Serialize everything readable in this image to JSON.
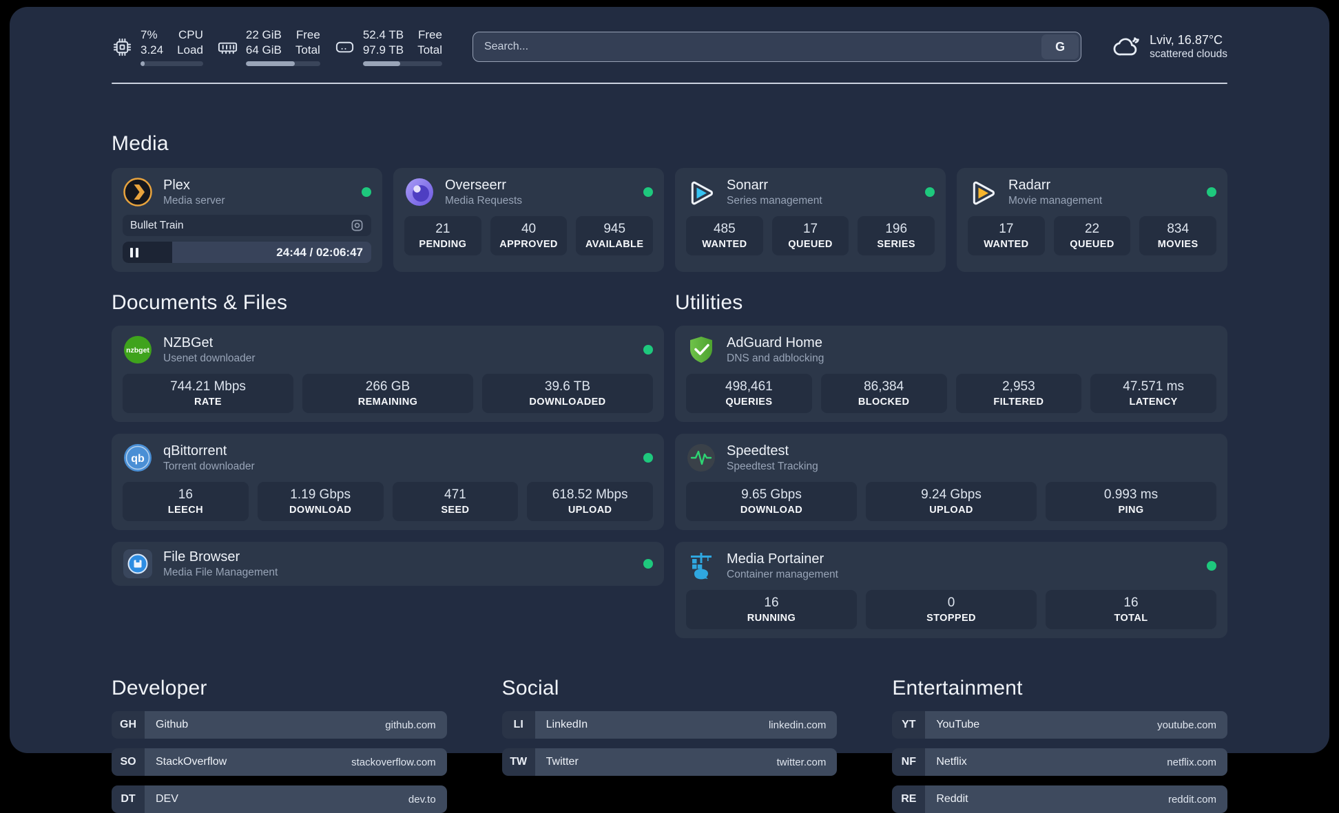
{
  "topbar": {
    "stats": [
      {
        "icon": "cpu",
        "v1": "7%",
        "v2": "3.24",
        "l1": "CPU",
        "l2": "Load",
        "progress": 7
      },
      {
        "icon": "ram",
        "v1": "22 GiB",
        "v2": "64 GiB",
        "l1": "Free",
        "l2": "Total",
        "progress": 66
      },
      {
        "icon": "disk",
        "v1": "52.4 TB",
        "v2": "97.9 TB",
        "l1": "Free",
        "l2": "Total",
        "progress": 47
      }
    ],
    "search": {
      "placeholder": "Search...",
      "engine": "G"
    },
    "weather": {
      "line1": "Lviv, 16.87°C",
      "line2": "scattered clouds"
    }
  },
  "media": {
    "heading": "Media",
    "plex": {
      "title": "Plex",
      "subtitle": "Media server",
      "now_playing": "Bullet Train",
      "time": "24:44 / 02:06:47",
      "progress": 20
    },
    "overseerr": {
      "title": "Overseerr",
      "subtitle": "Media Requests",
      "stats": [
        {
          "value": "21",
          "label": "PENDING"
        },
        {
          "value": "40",
          "label": "APPROVED"
        },
        {
          "value": "945",
          "label": "AVAILABLE"
        }
      ]
    },
    "sonarr": {
      "title": "Sonarr",
      "subtitle": "Series management",
      "stats": [
        {
          "value": "485",
          "label": "WANTED"
        },
        {
          "value": "17",
          "label": "QUEUED"
        },
        {
          "value": "196",
          "label": "SERIES"
        }
      ]
    },
    "radarr": {
      "title": "Radarr",
      "subtitle": "Movie management",
      "stats": [
        {
          "value": "17",
          "label": "WANTED"
        },
        {
          "value": "22",
          "label": "QUEUED"
        },
        {
          "value": "834",
          "label": "MOVIES"
        }
      ]
    }
  },
  "documents": {
    "heading": "Documents & Files",
    "nzbget": {
      "title": "NZBGet",
      "subtitle": "Usenet downloader",
      "stats": [
        {
          "value": "744.21 Mbps",
          "label": "RATE"
        },
        {
          "value": "266 GB",
          "label": "REMAINING"
        },
        {
          "value": "39.6 TB",
          "label": "DOWNLOADED"
        }
      ]
    },
    "qbittorrent": {
      "title": "qBittorrent",
      "subtitle": "Torrent downloader",
      "stats": [
        {
          "value": "16",
          "label": "LEECH"
        },
        {
          "value": "1.19 Gbps",
          "label": "DOWNLOAD"
        },
        {
          "value": "471",
          "label": "SEED"
        },
        {
          "value": "618.52 Mbps",
          "label": "UPLOAD"
        }
      ]
    },
    "filebrowser": {
      "title": "File Browser",
      "subtitle": "Media File Management"
    }
  },
  "utilities": {
    "heading": "Utilities",
    "adguard": {
      "title": "AdGuard Home",
      "subtitle": "DNS and adblocking",
      "stats": [
        {
          "value": "498,461",
          "label": "QUERIES"
        },
        {
          "value": "86,384",
          "label": "BLOCKED"
        },
        {
          "value": "2,953",
          "label": "FILTERED"
        },
        {
          "value": "47.571 ms",
          "label": "LATENCY"
        }
      ]
    },
    "speedtest": {
      "title": "Speedtest",
      "subtitle": "Speedtest Tracking",
      "stats": [
        {
          "value": "9.65 Gbps",
          "label": "DOWNLOAD"
        },
        {
          "value": "9.24 Gbps",
          "label": "UPLOAD"
        },
        {
          "value": "0.993 ms",
          "label": "PING"
        }
      ]
    },
    "portainer": {
      "title": "Media Portainer",
      "subtitle": "Container management",
      "stats": [
        {
          "value": "16",
          "label": "RUNNING"
        },
        {
          "value": "0",
          "label": "STOPPED"
        },
        {
          "value": "16",
          "label": "TOTAL"
        }
      ]
    }
  },
  "links": {
    "developer": {
      "heading": "Developer",
      "items": [
        {
          "abbr": "GH",
          "name": "Github",
          "url": "github.com"
        },
        {
          "abbr": "SO",
          "name": "StackOverflow",
          "url": "stackoverflow.com"
        },
        {
          "abbr": "DT",
          "name": "DEV",
          "url": "dev.to"
        }
      ]
    },
    "social": {
      "heading": "Social",
      "items": [
        {
          "abbr": "LI",
          "name": "LinkedIn",
          "url": "linkedin.com"
        },
        {
          "abbr": "TW",
          "name": "Twitter",
          "url": "twitter.com"
        }
      ]
    },
    "entertainment": {
      "heading": "Entertainment",
      "items": [
        {
          "abbr": "YT",
          "name": "YouTube",
          "url": "youtube.com"
        },
        {
          "abbr": "NF",
          "name": "Netflix",
          "url": "netflix.com"
        },
        {
          "abbr": "RE",
          "name": "Reddit",
          "url": "reddit.com"
        }
      ]
    }
  },
  "icon_labels": {
    "nzbget": "nzbget",
    "qbittorrent": "qb"
  },
  "colors": {
    "status_online": "#1ec87d",
    "plex_accent": "#e8a33d"
  }
}
